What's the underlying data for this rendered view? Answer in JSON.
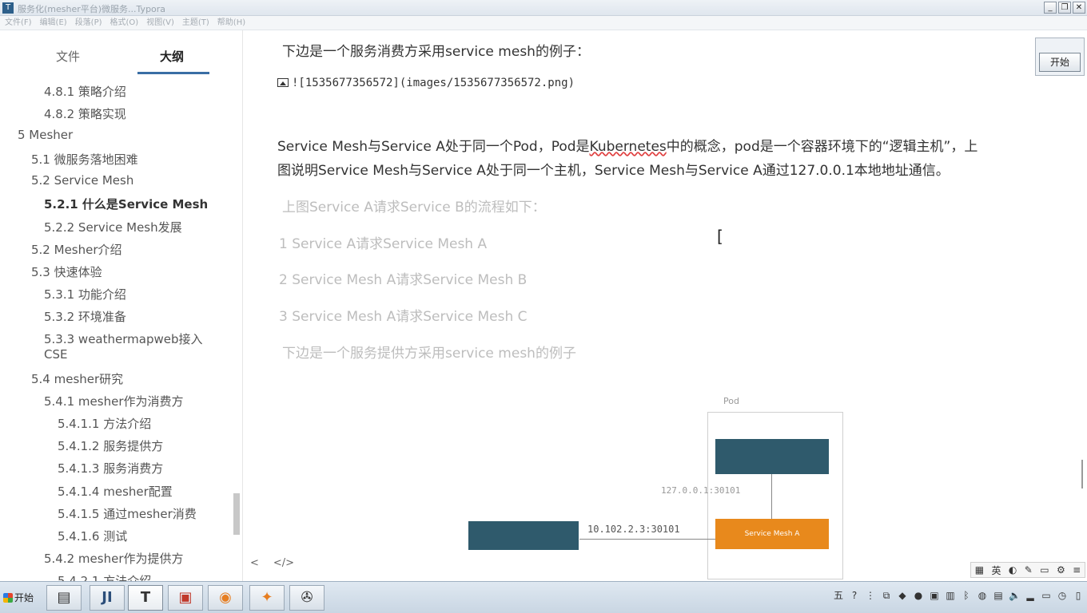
{
  "window": {
    "title": "服务化(mesher平台)微服务...Typora"
  },
  "menu": [
    "文件(F)",
    "编辑(E)",
    "段落(P)",
    "格式(O)",
    "视图(V)",
    "主题(T)",
    "帮助(H)"
  ],
  "sidebar": {
    "tabs": {
      "files": "文件",
      "outline": "大纲"
    },
    "items": [
      "4.8.1 策略介绍",
      "4.8.2 策略实现",
      "5 Mesher",
      "5.1 微服务落地困难",
      "5.2 Service Mesh",
      "5.2.1 什么是Service Mesh",
      "5.2.2 Service Mesh发展",
      "5.2 Mesher介绍",
      "5.3 快速体验",
      "5.3.1 功能介绍",
      "5.3.2 环境准备",
      "5.3.3 weathermapweb接入",
      "CSE",
      "5.4 mesher研究",
      "5.4.1 mesher作为消费方",
      "5.4.1.1 方法介绍",
      "5.4.1.2 服务提供方",
      "5.4.1.3 服务消费方",
      "5.4.1.4 mesher配置",
      "5.4.1.5 通过mesher消费",
      "5.4.1.6 测试",
      "5.4.2 mesher作为提供方",
      "5.4.2.1 方法介绍"
    ]
  },
  "content": {
    "heading_line": "下边是一个服务消费方采用service mesh的例子：",
    "image_ref": "![1535677356572](images/1535677356572.png)",
    "para1_a": "Service Mesh与Service A处于同一个Pod，Pod是",
    "para1_kube": "Kubernetes",
    "para1_b": "中的概念，pod是一个容器环境下的“逻辑主机”，上",
    "para2": "图说明Service Mesh与Service A处于同一个主机，Service Mesh与Service A通过127.0.0.1本地地址通信。",
    "faded1": "上图Service A请求Service B的流程如下：",
    "faded2": "1   Service A请求Service Mesh A",
    "faded3": "2   Service Mesh A请求Service Mesh B",
    "faded4": "3   Service Mesh A请求Service Mesh C",
    "faded5": "下边是一个服务提供方采用service mesh的例子"
  },
  "diagram": {
    "pod_label": "Pod",
    "local_addr": "127.0.0.1:30101",
    "ip_addr": "10.102.2.3:30101",
    "mesh_label": "Service Mesh A"
  },
  "editor_footer": {
    "back": "<",
    "source": "</>"
  },
  "overlay": {
    "start_label": "开始"
  },
  "ime": {
    "lang": "英"
  },
  "taskbar": {
    "start": "开始",
    "apps": [
      "",
      "JI",
      "T",
      "",
      "",
      "",
      ""
    ]
  }
}
